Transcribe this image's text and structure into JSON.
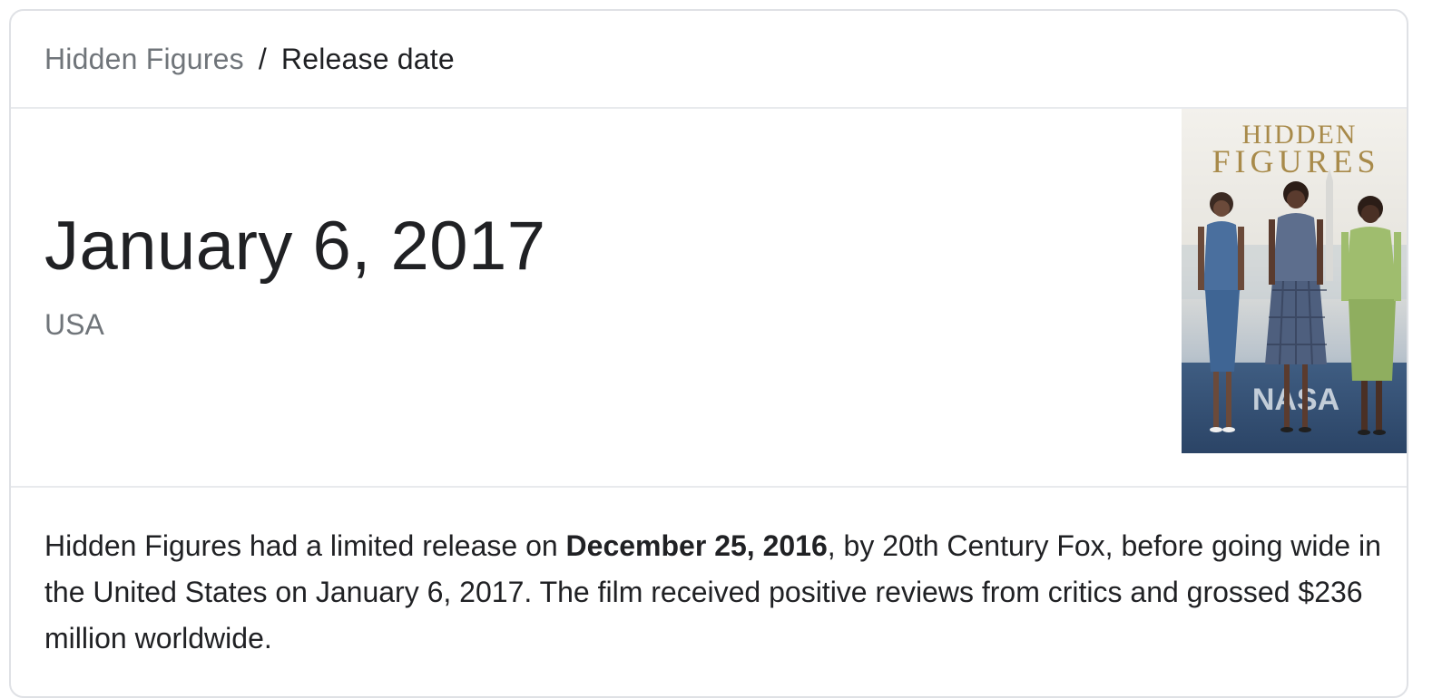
{
  "breadcrumb": {
    "parent": "Hidden Figures",
    "separator": "/",
    "current": "Release date"
  },
  "answer": {
    "date": "January 6, 2017",
    "region": "USA"
  },
  "poster": {
    "title_line1": "HIDDEN",
    "title_line2": "FIGURES",
    "ground_text": "NASA"
  },
  "description": {
    "part1": "Hidden Figures had a limited release on ",
    "bold": "December 25, 2016",
    "part2": ", by 20th Century Fox, before going wide in the United States on January 6, 2017. The film received positive reviews from critics and grossed $236 million worldwide."
  },
  "colors": {
    "text_primary": "#202124",
    "text_secondary": "#70757a",
    "border": "#dfe1e5",
    "divider": "#e8eaed",
    "poster_title_gold": "#a88a4a"
  }
}
